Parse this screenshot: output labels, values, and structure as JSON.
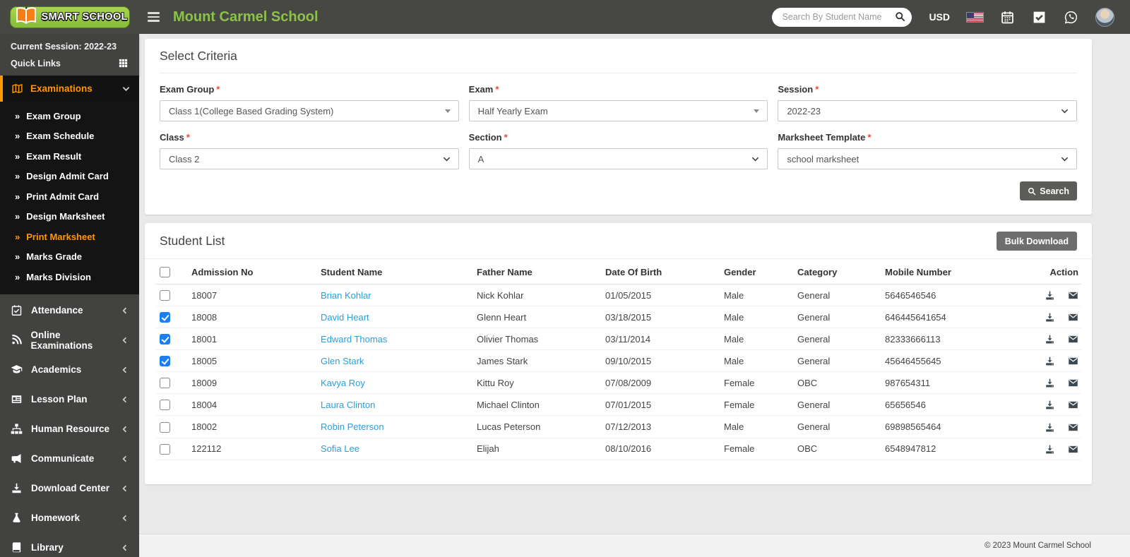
{
  "app": {
    "logo_text": "SMART SCHOOL",
    "title": "Mount Carmel School",
    "search_placeholder": "Search By Student Name",
    "currency": "USD",
    "header_icons": [
      "search-icon",
      "us-flag-icon",
      "calendar-icon",
      "check-square-icon",
      "whatsapp-icon",
      "user-avatar"
    ]
  },
  "colors": {
    "accent_orange": "#ff9800",
    "brand_green": "#8bc34a",
    "link_blue": "#2b9fd9",
    "header_bg": "#474744",
    "sidebar_bg": "#424240",
    "submenu_bg": "#141414",
    "content_bg": "#e9e9e9",
    "checkbox_blue": "#1c7ef0",
    "required_red": "#f44336"
  },
  "sidebar": {
    "session_label": "Current Session: 2022-23",
    "quick_links_label": "Quick Links",
    "quick_links_icon": "grid-icon",
    "active_section": {
      "label": "Examinations",
      "icon": "map-icon"
    },
    "submenu": [
      {
        "label": "Exam Group",
        "active": false
      },
      {
        "label": "Exam Schedule",
        "active": false
      },
      {
        "label": "Exam Result",
        "active": false
      },
      {
        "label": "Design Admit Card",
        "active": false
      },
      {
        "label": "Print Admit Card",
        "active": false
      },
      {
        "label": "Design Marksheet",
        "active": false
      },
      {
        "label": "Print Marksheet",
        "active": true
      },
      {
        "label": "Marks Grade",
        "active": false
      },
      {
        "label": "Marks Division",
        "active": false
      }
    ],
    "items": [
      {
        "label": "Attendance",
        "icon": "calendar-check-icon"
      },
      {
        "label": "Online Examinations",
        "icon": "rss-icon"
      },
      {
        "label": "Academics",
        "icon": "graduation-cap-icon"
      },
      {
        "label": "Lesson Plan",
        "icon": "newspaper-icon"
      },
      {
        "label": "Human Resource",
        "icon": "sitemap-icon"
      },
      {
        "label": "Communicate",
        "icon": "bullhorn-icon"
      },
      {
        "label": "Download Center",
        "icon": "download-icon"
      },
      {
        "label": "Homework",
        "icon": "flask-icon"
      },
      {
        "label": "Library",
        "icon": "book-icon"
      }
    ]
  },
  "criteria": {
    "title": "Select Criteria",
    "fields": [
      {
        "label": "Exam Group",
        "value": "Class 1(College Based Grading System)"
      },
      {
        "label": "Exam",
        "value": "Half Yearly Exam"
      },
      {
        "label": "Session",
        "value": "2022-23"
      },
      {
        "label": "Class",
        "value": "Class 2"
      },
      {
        "label": "Section",
        "value": "A"
      },
      {
        "label": "Marksheet Template",
        "value": "school marksheet"
      }
    ],
    "search_button": "Search"
  },
  "student_list": {
    "title": "Student List",
    "bulk_download_button": "Bulk Download",
    "columns": [
      "Admission No",
      "Student Name",
      "Father Name",
      "Date Of Birth",
      "Gender",
      "Category",
      "Mobile Number",
      "Action"
    ],
    "action_icons": [
      "download-icon",
      "envelope-icon"
    ],
    "rows": [
      {
        "checked": false,
        "admission_no": "18007",
        "student_name": "Brian Kohlar",
        "father_name": "Nick Kohlar",
        "dob": "01/05/2015",
        "gender": "Male",
        "category": "General",
        "mobile": "5646546546"
      },
      {
        "checked": true,
        "admission_no": "18008",
        "student_name": "David Heart",
        "father_name": "Glenn Heart",
        "dob": "03/18/2015",
        "gender": "Male",
        "category": "General",
        "mobile": "646445641654"
      },
      {
        "checked": true,
        "admission_no": "18001",
        "student_name": "Edward Thomas",
        "father_name": "Olivier Thomas",
        "dob": "03/11/2014",
        "gender": "Male",
        "category": "General",
        "mobile": "82333666113"
      },
      {
        "checked": true,
        "admission_no": "18005",
        "student_name": "Glen Stark",
        "father_name": "James Stark",
        "dob": "09/10/2015",
        "gender": "Male",
        "category": "General",
        "mobile": "45646455645"
      },
      {
        "checked": false,
        "admission_no": "18009",
        "student_name": "Kavya Roy",
        "father_name": "Kittu Roy",
        "dob": "07/08/2009",
        "gender": "Female",
        "category": "OBC",
        "mobile": "987654311"
      },
      {
        "checked": false,
        "admission_no": "18004",
        "student_name": "Laura Clinton",
        "father_name": "Michael Clinton",
        "dob": "07/01/2015",
        "gender": "Female",
        "category": "General",
        "mobile": "65656546"
      },
      {
        "checked": false,
        "admission_no": "18002",
        "student_name": "Robin Peterson",
        "father_name": "Lucas Peterson",
        "dob": "07/12/2013",
        "gender": "Male",
        "category": "General",
        "mobile": "69898565464"
      },
      {
        "checked": false,
        "admission_no": "122112",
        "student_name": "Sofia Lee",
        "father_name": "Elijah",
        "dob": "08/10/2016",
        "gender": "Female",
        "category": "OBC",
        "mobile": "6548947812"
      }
    ]
  },
  "footer": {
    "copyright": "© 2023 Mount Carmel School"
  }
}
